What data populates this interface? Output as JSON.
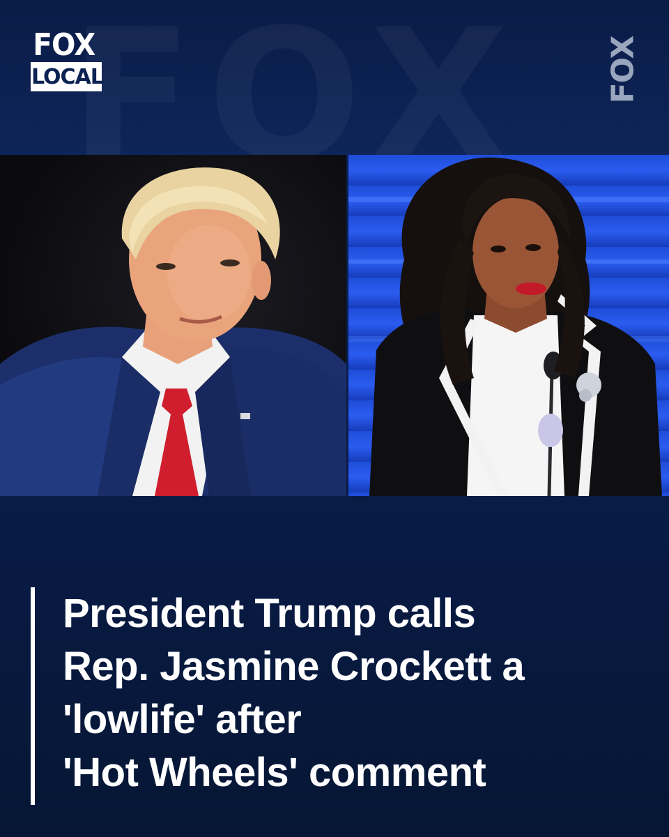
{
  "brand": {
    "logo_line1": "FOX",
    "logo_line2": "LOCAL",
    "side_mark": "FOX",
    "watermark": "FOX"
  },
  "photos": {
    "left_subject": "man in navy suit with red tie",
    "right_subject": "woman at podium in black-and-white jacket"
  },
  "headline": {
    "lines": [
      "President Trump calls",
      "Rep. Jasmine Crockett a",
      "'lowlife' after",
      "'Hot Wheels' comment"
    ]
  },
  "colors": {
    "background": "#0a1f4d",
    "text": "#ffffff",
    "accent_bar": "#ffffff"
  }
}
